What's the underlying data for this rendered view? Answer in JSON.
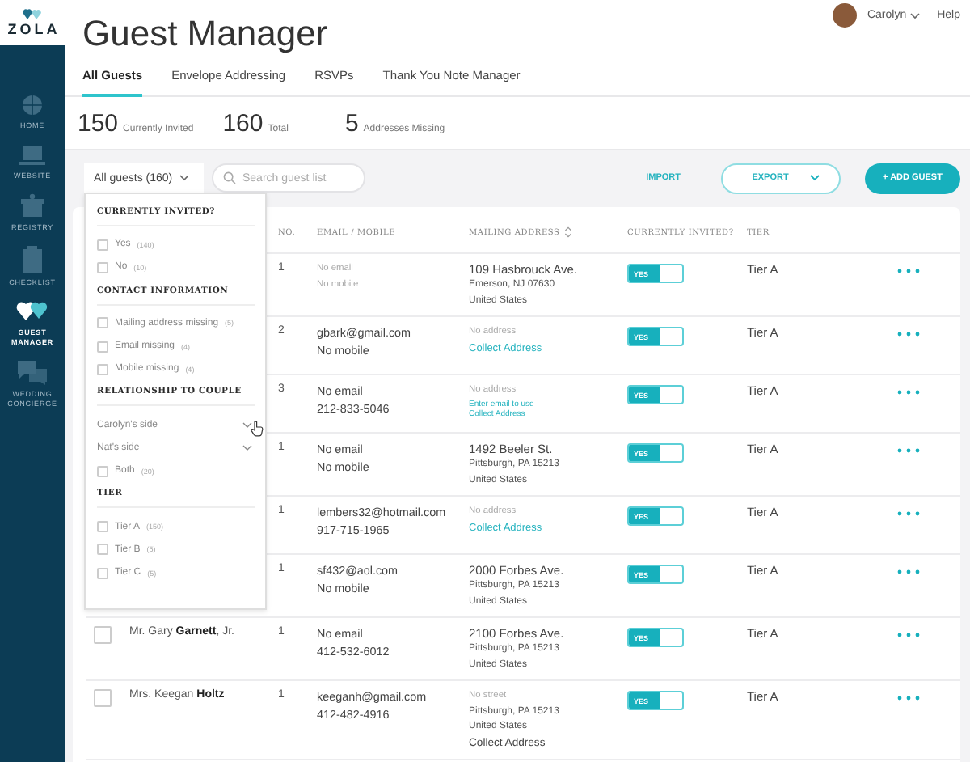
{
  "sidebar": {
    "logo": "ZOLA",
    "items": [
      {
        "label": "HOME",
        "selected": false
      },
      {
        "label": "WEBSITE",
        "selected": false
      },
      {
        "label": "REGISTRY",
        "selected": false
      },
      {
        "label": "CHECKLIST",
        "selected": false
      },
      {
        "label": "GUEST MANAGER",
        "selected": true
      },
      {
        "label": "WEDDING CONCIERGE",
        "selected": false
      }
    ]
  },
  "header": {
    "title": "Guest Manager",
    "user": "Carolyn",
    "help": "Help"
  },
  "tabs": [
    {
      "label": "All Guests",
      "selected": true
    },
    {
      "label": "Envelope Addressing",
      "selected": false
    },
    {
      "label": "RSVPs",
      "selected": false
    },
    {
      "label": "Thank You Note Manager",
      "selected": false
    }
  ],
  "stats": [
    {
      "value": "150",
      "label": "Currently Invited"
    },
    {
      "value": "160",
      "label": "Total"
    },
    {
      "value": "5",
      "label": "Addresses Missing"
    }
  ],
  "toolbar": {
    "filter": "All guests (160)",
    "search_placeholder": "Search guest list",
    "import": "IMPORT",
    "export": "EXPORT",
    "add": "+ ADD GUEST"
  },
  "filter_menu": {
    "sections": [
      {
        "title": "CURRENTLY INVITED?",
        "items": [
          {
            "kind": "checkbox",
            "label": "Yes",
            "count": "(140)",
            "checked": false
          },
          {
            "kind": "checkbox",
            "label": "No",
            "count": "(10)",
            "checked": false
          }
        ]
      },
      {
        "title": "CONTACT INFORMATION",
        "items": [
          {
            "kind": "checkbox",
            "label": "Mailing address missing",
            "count": "(5)",
            "checked": false
          },
          {
            "kind": "checkbox",
            "label": "Email missing",
            "count": "(4)",
            "checked": false
          },
          {
            "kind": "checkbox",
            "label": "Mobile missing",
            "count": "(4)",
            "checked": false
          }
        ]
      },
      {
        "title": "RELATIONSHIP TO COUPLE",
        "items": [
          {
            "kind": "expandable",
            "label": "Carolyn's side",
            "expanded": false,
            "hovered": true
          },
          {
            "kind": "expandable",
            "label": "Nat's side",
            "expanded": false,
            "hovered": false
          },
          {
            "kind": "checkbox",
            "label": "Both",
            "count": "(20)",
            "checked": false
          }
        ]
      },
      {
        "title": "TIER",
        "items": [
          {
            "kind": "checkbox",
            "label": "Tier A",
            "count": "(150)",
            "checked": false
          },
          {
            "kind": "checkbox",
            "label": "Tier B",
            "count": "(5)",
            "checked": false
          },
          {
            "kind": "checkbox",
            "label": "Tier C",
            "count": "(5)",
            "checked": false
          }
        ]
      }
    ]
  },
  "table": {
    "columns": [
      {
        "label": "NO.",
        "sortable": false
      },
      {
        "label": "EMAIL / MOBILE",
        "sortable": false
      },
      {
        "label": "MAILING ADDRESS",
        "sortable": true
      },
      {
        "label": "CURRENTLY INVITED?",
        "sortable": false
      },
      {
        "label": "TIER",
        "sortable": false
      }
    ],
    "rows": [
      {
        "no": "1",
        "contact": [
          {
            "text": "No email",
            "muted": true
          },
          {
            "text": "No mobile",
            "muted": true
          }
        ],
        "address": [
          {
            "kind": "street",
            "text": "109 Hasbrouck Ave."
          },
          {
            "kind": "city",
            "text": "Emerson, NJ 07630"
          },
          {
            "kind": "city",
            "text": "United States"
          }
        ],
        "invited": true,
        "invited_label": "YES",
        "tier": "Tier A"
      },
      {
        "no": "2",
        "contact": [
          {
            "text": "gbark@gmail.com",
            "muted": false
          },
          {
            "text": "No mobile",
            "muted": false
          }
        ],
        "address": [
          {
            "kind": "muted",
            "text": "No address"
          },
          {
            "kind": "link",
            "text": "Collect Address"
          }
        ],
        "invited": true,
        "invited_label": "YES",
        "tier": "Tier A"
      },
      {
        "no": "3",
        "contact": [
          {
            "text": "No email",
            "muted": false
          },
          {
            "text": "212-833-5046",
            "muted": false
          }
        ],
        "address": [
          {
            "kind": "muted",
            "text": "No address"
          },
          {
            "kind": "small_link",
            "text": "Enter email to use"
          },
          {
            "kind": "small_link",
            "text": "Collect Address"
          }
        ],
        "invited": true,
        "invited_label": "YES",
        "tier": "Tier A"
      },
      {
        "no": "1",
        "contact": [
          {
            "text": "No email",
            "muted": false
          },
          {
            "text": "No mobile",
            "muted": false
          }
        ],
        "address": [
          {
            "kind": "street",
            "text": "1492 Beeler St."
          },
          {
            "kind": "city",
            "text": "Pittsburgh, PA 15213"
          },
          {
            "kind": "city",
            "text": "United States"
          }
        ],
        "invited": true,
        "invited_label": "YES",
        "tier": "Tier A"
      },
      {
        "no": "1",
        "contact": [
          {
            "text": "lembers32@hotmail.com",
            "muted": false
          },
          {
            "text": "917-715-1965",
            "muted": false
          }
        ],
        "address": [
          {
            "kind": "muted",
            "text": "No address"
          },
          {
            "kind": "link",
            "text": "Collect Address"
          }
        ],
        "invited": true,
        "invited_label": "YES",
        "tier": "Tier A"
      },
      {
        "no": "1",
        "contact": [
          {
            "text": "sf432@aol.com",
            "muted": false
          },
          {
            "text": "No mobile",
            "muted": false
          }
        ],
        "address": [
          {
            "kind": "street",
            "text": "2000 Forbes Ave."
          },
          {
            "kind": "city",
            "text": "Pittsburgh, PA 15213"
          },
          {
            "kind": "city",
            "text": "United States"
          }
        ],
        "invited": true,
        "invited_label": "YES",
        "tier": "Tier A"
      },
      {
        "name": "Mr. Gary **Garnett**, Jr.",
        "selected": false,
        "no": "1",
        "contact": [
          {
            "text": "No email",
            "muted": false
          },
          {
            "text": "412-532-6012",
            "muted": false
          }
        ],
        "address": [
          {
            "kind": "street",
            "text": "2100 Forbes Ave."
          },
          {
            "kind": "city",
            "text": "Pittsburgh, PA 15213"
          },
          {
            "kind": "city",
            "text": "United States"
          }
        ],
        "invited": true,
        "invited_label": "YES",
        "tier": "Tier A"
      },
      {
        "name": "Mrs. Keegan **Holtz**",
        "selected": false,
        "no": "1",
        "contact": [
          {
            "text": "keeganh@gmail.com",
            "muted": false
          },
          {
            "text": "412-482-4916",
            "muted": false
          }
        ],
        "address": [
          {
            "kind": "muted",
            "text": "No street"
          },
          {
            "kind": "city",
            "text": "Pittsburgh, PA 15213"
          },
          {
            "kind": "city",
            "text": "United States"
          },
          {
            "kind": "plain",
            "text": "Collect Address"
          }
        ],
        "invited": true,
        "invited_label": "YES",
        "tier": "Tier A"
      }
    ]
  }
}
